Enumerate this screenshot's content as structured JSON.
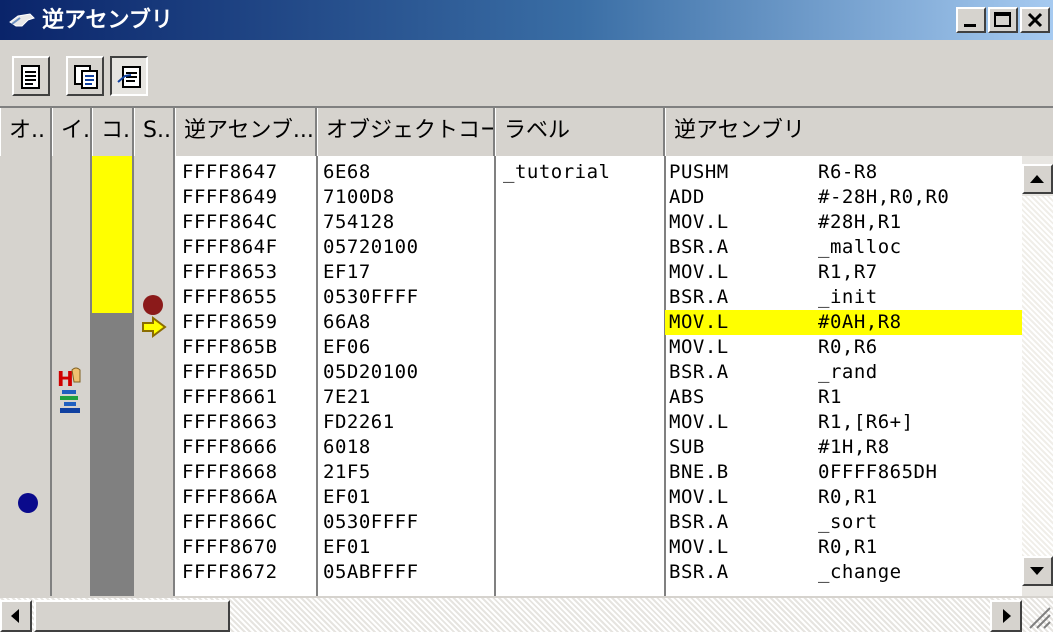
{
  "window": {
    "title": "逆アセンブリ"
  },
  "columns": [
    "オ..",
    "イ..",
    "コ..",
    "S..",
    "逆アセンブ...",
    "オブジェクトコー...",
    "ラベル",
    "逆アセンブリ"
  ],
  "rows": [
    {
      "address": "FFFF8647",
      "code": "6E68",
      "label": "_tutorial",
      "mnemonic": "PUSHM",
      "operand": "R6-R8"
    },
    {
      "address": "FFFF8649",
      "code": "7100D8",
      "label": "",
      "mnemonic": "ADD",
      "operand": "#-28H,R0,R0"
    },
    {
      "address": "FFFF864C",
      "code": "754128",
      "label": "",
      "mnemonic": "MOV.L",
      "operand": "#28H,R1"
    },
    {
      "address": "FFFF864F",
      "code": "05720100",
      "label": "",
      "mnemonic": "BSR.A",
      "operand": "_malloc"
    },
    {
      "address": "FFFF8653",
      "code": "EF17",
      "label": "",
      "mnemonic": "MOV.L",
      "operand": "R1,R7"
    },
    {
      "address": "FFFF8655",
      "code": "0530FFFF",
      "label": "",
      "mnemonic": "BSR.A",
      "operand": "_init"
    },
    {
      "address": "FFFF8659",
      "code": "66A8",
      "label": "",
      "mnemonic": "MOV.L",
      "operand": "#0AH,R8"
    },
    {
      "address": "FFFF865B",
      "code": "EF06",
      "label": "",
      "mnemonic": "MOV.L",
      "operand": "R0,R6"
    },
    {
      "address": "FFFF865D",
      "code": "05D20100",
      "label": "",
      "mnemonic": "BSR.A",
      "operand": "_rand"
    },
    {
      "address": "FFFF8661",
      "code": "7E21",
      "label": "",
      "mnemonic": "ABS",
      "operand": "R1"
    },
    {
      "address": "FFFF8663",
      "code": "FD2261",
      "label": "",
      "mnemonic": "MOV.L",
      "operand": "R1,[R6+]"
    },
    {
      "address": "FFFF8666",
      "code": "6018",
      "label": "",
      "mnemonic": "SUB",
      "operand": "#1H,R8"
    },
    {
      "address": "FFFF8668",
      "code": "21F5",
      "label": "",
      "mnemonic": "BNE.B",
      "operand": "0FFFF865DH"
    },
    {
      "address": "FFFF866A",
      "code": "EF01",
      "label": "",
      "mnemonic": "MOV.L",
      "operand": "R0,R1"
    },
    {
      "address": "FFFF866C",
      "code": "0530FFFF",
      "label": "",
      "mnemonic": "BSR.A",
      "operand": "_sort"
    },
    {
      "address": "FFFF8670",
      "code": "EF01",
      "label": "",
      "mnemonic": "MOV.L",
      "operand": "R0,R1"
    },
    {
      "address": "FFFF8672",
      "code": "05ABFFFF",
      "label": "",
      "mnemonic": "BSR.A",
      "operand": "_change"
    }
  ],
  "markers": {
    "breakpoint_icon": "breakpoint-dot-icon",
    "pc_icon": "pc-arrow-icon",
    "event_icon": "event-point-icon",
    "trace_icon": "trace-icon",
    "bookmark_icon": "bookmark-dot-icon"
  },
  "colors": {
    "highlight": "#ffff00",
    "coverage_executed": "#ffff00",
    "coverage_not": "#808080",
    "breakpoint": "#8b1a1a",
    "bookmark": "#0a0a8c"
  }
}
